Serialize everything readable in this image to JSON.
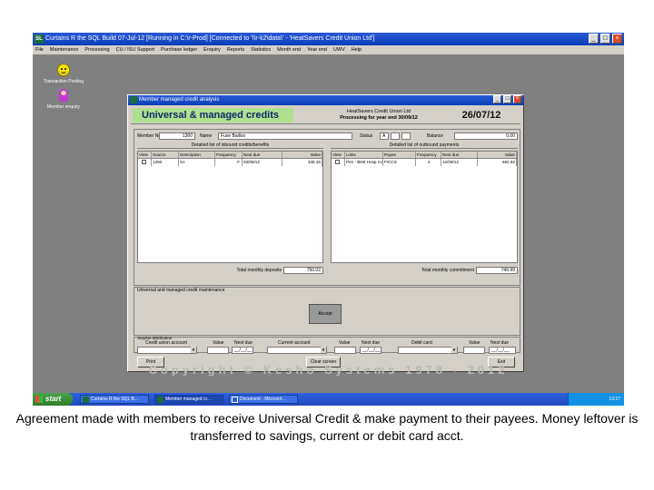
{
  "main_window": {
    "icon_label": "SL",
    "title": "Curtains R the SQL Build 07-Jul-12 [Running in C:\\r-Prod] [Connected to '\\\\r-k2\\data\\' - 'HeatSavers Credit Union Ltd']",
    "buttons": {
      "minimize": "_",
      "maximize": "□",
      "close": "×"
    }
  },
  "menu": [
    "File",
    "Maintenance",
    "Processing",
    "CU / ISU Support",
    "Purchase ledger",
    "Enquiry",
    "Reports",
    "Statistics",
    "Month end",
    "Year end",
    "UWV",
    "Help"
  ],
  "desktop_icons": [
    {
      "label": "Transaction Posting",
      "icon": "smiley-icon"
    },
    {
      "label": "Member enquiry",
      "icon": "member-icon"
    }
  ],
  "dialog": {
    "title": "Member managed credit analysis",
    "app_name": "Universal & managed credits",
    "org_line1": "HeatSavers Credit Union Ltd",
    "org_line2": "Processing for year end 30/09/12",
    "date": "26/07/12",
    "member_no_label": "Member No",
    "member_no": "1360",
    "name_label": "Name",
    "name": "Fuse Bailiss",
    "status_label": "Status",
    "status": "A",
    "balance_label": "Balance",
    "balance": "0.00",
    "inbound_title": "Detailed list of inbound credits/benefits",
    "outbound_title": "Detailed list of outbound payments",
    "inbound_columns": [
      "View",
      "Source",
      "Description",
      "Frequency",
      "Next due",
      "Value"
    ],
    "inbound_rows": [
      [
        "",
        "1360",
        "S1",
        "F",
        "03/08/12",
        "345.15"
      ]
    ],
    "outbound_columns": [
      "View",
      "Links",
      "Payee",
      "Frequency",
      "Next due",
      "Value"
    ],
    "outbound_rows": [
      [
        "",
        "Pen - Blett Hosp Corp",
        "FICCS",
        "4",
        "12/08/12",
        "692.92"
      ]
    ],
    "total_in_label": "Total monthly deposits",
    "total_in": "750.02",
    "total_out_label": "Total monthly commitment",
    "total_out": "749.99",
    "maintenance_title": "Universal and managed credit maintenance",
    "accept_label": "Accept",
    "surplus_title": "Surplus distribution",
    "credit_union_acct_label": "Credit union account",
    "value_label": "Value",
    "next_due_label": "Next due",
    "current_acct_label": "Current account",
    "debit_card_label": "Debit card",
    "date_placeholder": "__/__/__",
    "print_label": "Print",
    "clear_label": "Clear screen",
    "exit_label": "Exit"
  },
  "copyright": "Copyright © Kesho Systems 1978 - 2012",
  "taskbar": {
    "start_label": "start",
    "tasks": [
      "Curtains R the SQL B...",
      "Member managed cr...",
      "Document - Microsof..."
    ],
    "clock": "13:27"
  },
  "caption": "Agreement made with members to receive Universal Credit & make payment to their payees. Money leftover is transferred to savings, current or debit card acct."
}
